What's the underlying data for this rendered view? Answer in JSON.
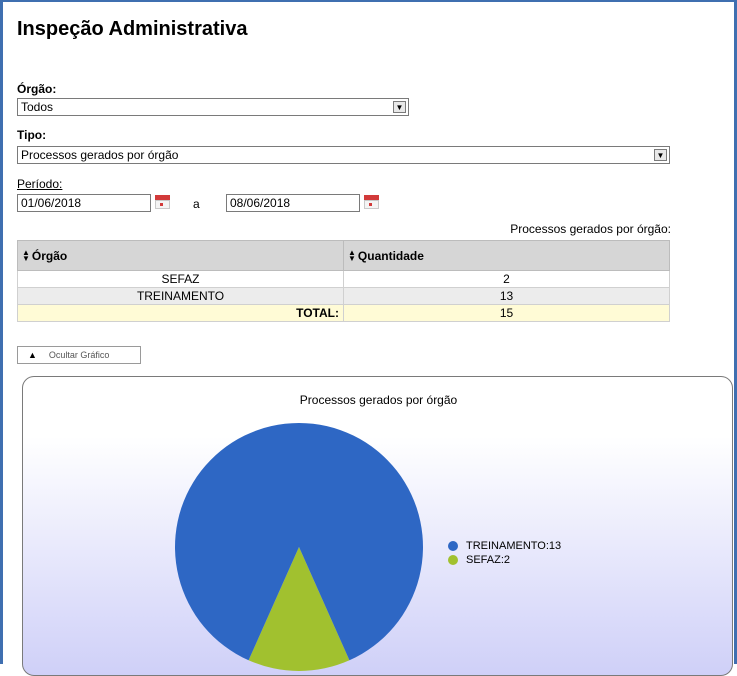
{
  "page": {
    "title": "Inspeção Administrativa"
  },
  "orgao": {
    "label": "Órgão:",
    "value": "Todos"
  },
  "tipo": {
    "label": "Tipo:",
    "value": "Processos gerados por órgão"
  },
  "periodo": {
    "label": "Período:",
    "start": "01/06/2018",
    "separator": "a",
    "end": "08/06/2018"
  },
  "table": {
    "caption": "Processos gerados por órgão:",
    "headers": [
      "Órgão",
      "Quantidade"
    ],
    "rows": [
      {
        "orgao": "SEFAZ",
        "quantidade": "2"
      },
      {
        "orgao": "TREINAMENTO",
        "quantidade": "13"
      }
    ],
    "total_label": "TOTAL:",
    "total_value": "15"
  },
  "toggle": {
    "label": "Ocultar Gráfico"
  },
  "colors": {
    "frame": "#3f6fb0",
    "treinamento": "#2e67c4",
    "sefaz": "#a1c12f"
  },
  "chart_data": {
    "type": "pie",
    "title": "Processos gerados por órgão",
    "categories": [
      "TREINAMENTO",
      "SEFAZ"
    ],
    "values": [
      13,
      2
    ],
    "legend_labels": [
      "TREINAMENTO:13",
      "SEFAZ:2"
    ],
    "legend": "right"
  }
}
